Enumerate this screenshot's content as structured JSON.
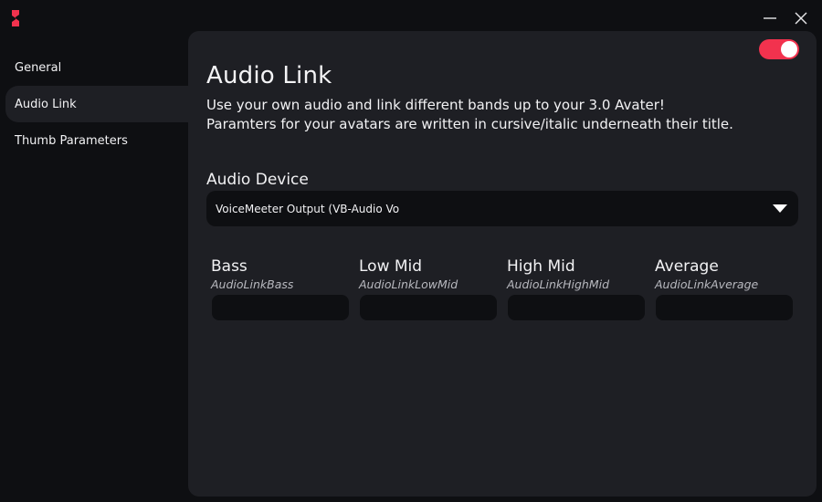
{
  "app": {
    "logo_icon": "app-logo-icon",
    "accent_color": "#f2324e"
  },
  "window_controls": {
    "minimize_icon": "minimize-icon",
    "close_icon": "close-icon"
  },
  "sidebar": {
    "items": [
      {
        "label": "General",
        "active": false
      },
      {
        "label": "Audio Link",
        "active": true
      },
      {
        "label": "Thumb Parameters",
        "active": false
      }
    ]
  },
  "main": {
    "enabled": true,
    "title": "Audio Link",
    "description_line1": "Use your own audio and link different bands up to your 3.0 Avater!",
    "description_line2": "Paramters for your avatars are written in cursive/italic underneath their title.",
    "audio_device": {
      "label": "Audio Device",
      "selected": "VoiceMeeter Output (VB-Audio Vo"
    },
    "bands": [
      {
        "title": "Bass",
        "param": "AudioLinkBass",
        "value": ""
      },
      {
        "title": "Low Mid",
        "param": "AudioLinkLowMid",
        "value": ""
      },
      {
        "title": "High Mid",
        "param": "AudioLinkHighMid",
        "value": ""
      },
      {
        "title": "Average",
        "param": "AudioLinkAverage",
        "value": ""
      }
    ]
  }
}
